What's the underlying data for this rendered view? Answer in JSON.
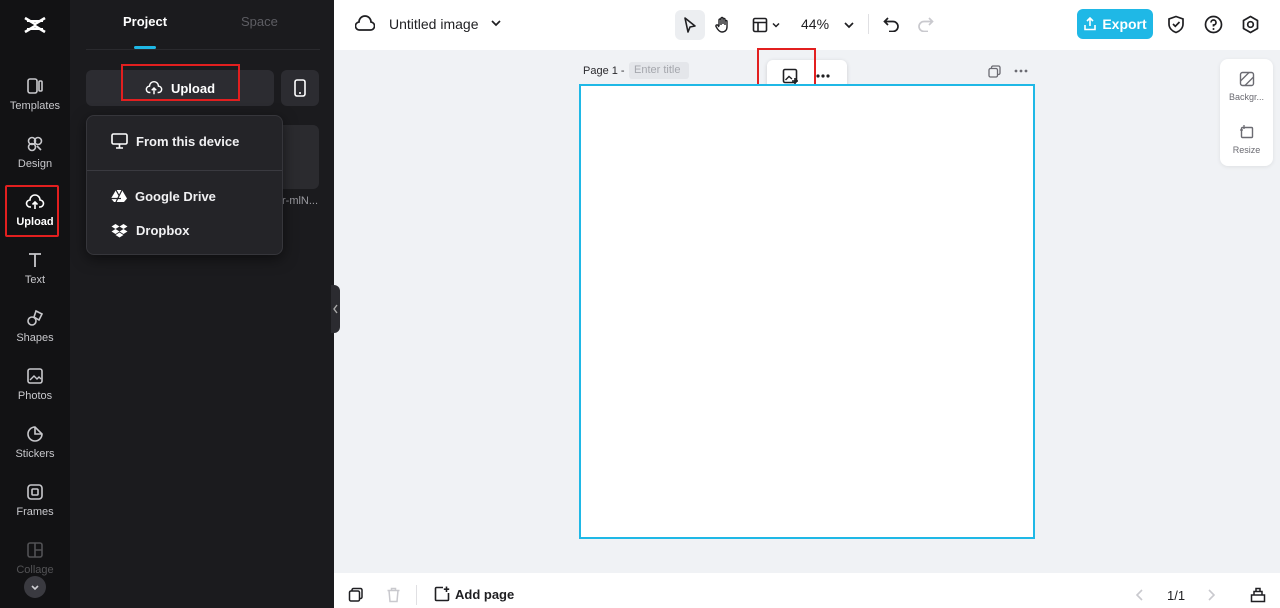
{
  "sidebar": {
    "items": [
      {
        "label": "Templates",
        "icon": "templates-icon"
      },
      {
        "label": "Design",
        "icon": "design-icon"
      },
      {
        "label": "Upload",
        "icon": "upload-cloud-icon"
      },
      {
        "label": "Text",
        "icon": "text-icon"
      },
      {
        "label": "Shapes",
        "icon": "shapes-icon"
      },
      {
        "label": "Photos",
        "icon": "photos-icon"
      },
      {
        "label": "Stickers",
        "icon": "stickers-icon"
      },
      {
        "label": "Frames",
        "icon": "frames-icon"
      },
      {
        "label": "Collage",
        "icon": "collage-icon"
      }
    ]
  },
  "panel": {
    "tabs": [
      {
        "label": "Project"
      },
      {
        "label": "Space"
      }
    ],
    "upload_label": "Upload",
    "media_item_caption": "r-mlN...",
    "upload_menu": [
      {
        "label": "From this device",
        "icon": "monitor-icon"
      },
      {
        "label": "Google Drive",
        "icon": "google-drive-icon"
      },
      {
        "label": "Dropbox",
        "icon": "dropbox-icon"
      }
    ]
  },
  "topbar": {
    "title": "Untitled image",
    "zoom": "44%",
    "export_label": "Export"
  },
  "canvas": {
    "page_label": "Page 1 -",
    "title_placeholder": "Enter title"
  },
  "side_tools": [
    {
      "label": "Backgr...",
      "icon": "background-icon"
    },
    {
      "label": "Resize",
      "icon": "resize-icon"
    }
  ],
  "bottombar": {
    "add_page_label": "Add page",
    "pagination": "1/1"
  },
  "colors": {
    "accent": "#1fb8e6",
    "highlight": "#e21f1f",
    "rail_bg": "#121214",
    "panel_bg": "#1b1b1e"
  }
}
